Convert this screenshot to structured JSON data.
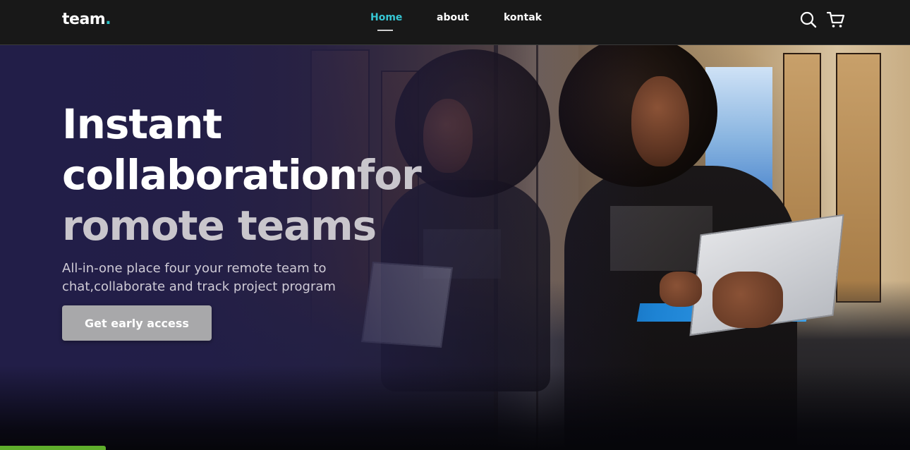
{
  "navbar": {
    "logo_text": "team",
    "logo_dot": ".",
    "links": [
      {
        "label": "Home",
        "active": true
      },
      {
        "label": "about",
        "active": false
      },
      {
        "label": "kontak",
        "active": false
      }
    ],
    "icons": [
      "search-icon",
      "cart-icon"
    ]
  },
  "hero": {
    "title_line1": "Instant",
    "title_line2_main": "collaboration",
    "title_line2_muted": "for",
    "title_line3": "romote teams",
    "subtitle_line1": "All-in-one place four your remote team to",
    "subtitle_line2": "chat,collaborate and track project program",
    "cta_label": "Get early access"
  },
  "colors": {
    "accent": "#36c6d3",
    "nav_bg": "#181818",
    "overlay": "#221e48",
    "cta_bg": "#a8a8aa"
  }
}
